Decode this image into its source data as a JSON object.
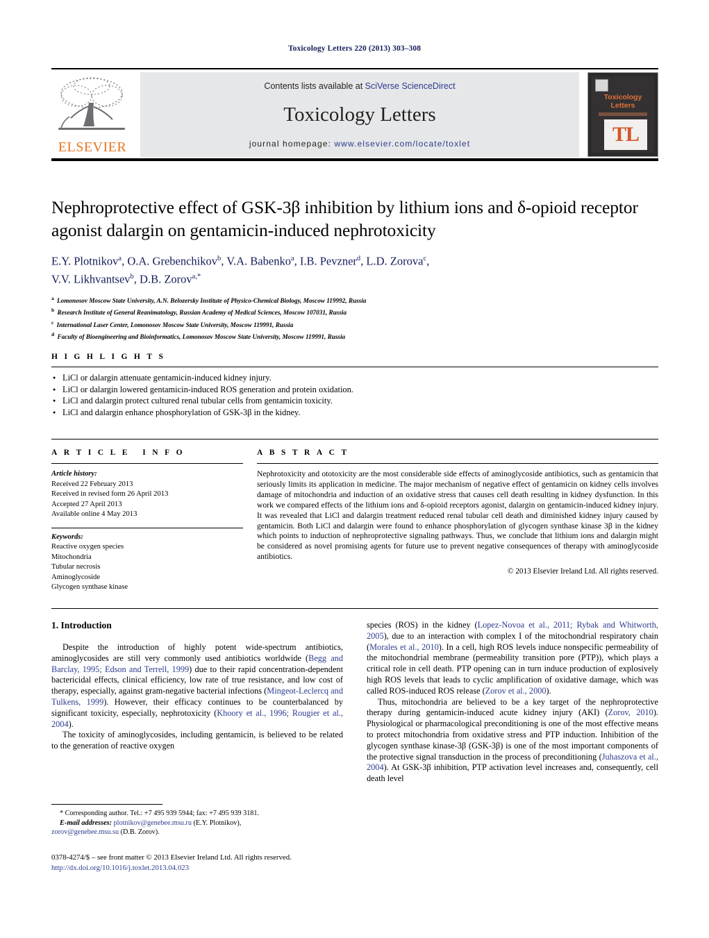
{
  "running_head": "Toxicology Letters 220 (2013) 303–308",
  "masthead": {
    "contents_prefix": "Contents lists available at ",
    "sciencedirect": "SciVerse ScienceDirect",
    "journal_name": "Toxicology Letters",
    "homepage_prefix": "journal homepage: ",
    "homepage_url": "www.elsevier.com/locate/toxlet",
    "publisher_wordmark": "ELSEVIER",
    "cover_title": "Toxicology Letters",
    "cover_monogram": "TL",
    "accent_orange": "#e87722",
    "link_blue": "#2c3b8f",
    "panel_gray": "#e6e7e8"
  },
  "article": {
    "title": "Nephroprotective effect of GSK-3β inhibition by lithium ions and δ-opioid receptor agonist dalargin on gentamicin-induced nephrotoxicity",
    "authors_line_1": "E.Y. Plotnikov<sup>a</sup>, O.A. Grebenchikov<sup>b</sup>, V.A. Babenko<sup>a</sup>, I.B. Pevzner<sup>d</sup>, L.D. Zorova<sup>c</sup>,",
    "authors_line_2": "V.V. Likhvantsev<sup>b</sup>, D.B. Zorov<sup>a,</sup><sup>*</sup>",
    "affiliations": [
      "<sup>a</sup> Lomonosov Moscow State University, A.N. Belozersky Institute of Physico-Chemical Biology, Moscow 119992, Russia",
      "<sup>b</sup> Research Institute of General Reanimatology, Russian Academy of Medical Sciences, Moscow 107031, Russia",
      "<sup>c</sup> International Laser Center, Lomonosov Moscow State University, Moscow 119991, Russia",
      "<sup>d</sup> Faculty of Bioengineering and Bioinformatics, Lomonosov Moscow State University, Moscow 119991, Russia"
    ]
  },
  "highlights": {
    "label": "HIGHLIGHTS",
    "items": [
      "LiCl or dalargin attenuate gentamicin-induced kidney injury.",
      "LiCl or dalargin lowered gentamicin-induced ROS generation and protein oxidation.",
      "LiCl and dalargin protect cultured renal tubular cells from gentamicin toxicity.",
      "LiCl and dalargin enhance phosphorylation of GSK-3β in the kidney."
    ]
  },
  "article_info": {
    "label": "ARTICLE INFO",
    "history_label": "Article history:",
    "history": [
      "Received 22 February 2013",
      "Received in revised form 26 April 2013",
      "Accepted 27 April 2013",
      "Available online 4 May 2013"
    ],
    "keywords_label": "Keywords:",
    "keywords": [
      "Reactive oxygen species",
      "Mitochondria",
      "Tubular necrosis",
      "Aminoglycoside",
      "Glycogen synthase kinase"
    ]
  },
  "abstract": {
    "label": "ABSTRACT",
    "text": "Nephrotoxicity and ototoxicity are the most considerable side effects of aminoglycoside antibiotics, such as gentamicin that seriously limits its application in medicine. The major mechanism of negative effect of gentamicin on kidney cells involves damage of mitochondria and induction of an oxidative stress that causes cell death resulting in kidney dysfunction. In this work we compared effects of the lithium ions and δ-opioid receptors agonist, dalargin on gentamicin-induced kidney injury. It was revealed that LiCl and dalargin treatment reduced renal tubular cell death and diminished kidney injury caused by gentamicin. Both LiCl and dalargin were found to enhance phosphorylation of glycogen synthase kinase 3β in the kidney which points to induction of nephroprotective signaling pathways. Thus, we conclude that lithium ions and dalargin might be considered as novel promising agents for future use to prevent negative consequences of therapy with aminoglycoside antibiotics.",
    "copyright": "© 2013 Elsevier Ireland Ltd. All rights reserved."
  },
  "introduction": {
    "heading": "1. Introduction",
    "left_paragraphs": [
      "Despite the introduction of highly potent wide-spectrum antibiotics, aminoglycosides are still very commonly used antibiotics worldwide (<span class=\"cite\">Begg and Barclay, 1995; Edson and Terrell, 1999</span>) due to their rapid concentration-dependent bactericidal effects, clinical efficiency, low rate of true resistance, and low cost of therapy, especially, against gram-negative bacterial infections (<span class=\"cite\">Mingeot-Leclercq and Tulkens, 1999</span>). However, their efficacy continues to be counterbalanced by significant toxicity, especially, nephrotoxicity (<span class=\"cite\">Khoory et al., 1996; Rougier et al., 2004</span>).",
      "The toxicity of aminoglycosides, including gentamicin, is believed to be related to the generation of reactive oxygen"
    ],
    "right_paragraphs": [
      "species (ROS) in the kidney (<span class=\"cite\">Lopez-Novoa et al., 2011; Rybak and Whitworth, 2005</span>), due to an interaction with complex I of the mitochondrial respiratory chain (<span class=\"cite\">Morales et al., 2010</span>). In a cell, high ROS levels induce nonspecific permeability of the mitochondrial membrane (permeability transition pore (PTP)), which plays a critical role in cell death. PTP opening can in turn induce production of explosively high ROS levels that leads to cyclic amplification of oxidative damage, which was called ROS-induced ROS release (<span class=\"cite\">Zorov et al., 2000</span>).",
      "Thus, mitochondria are believed to be a key target of the nephroprotective therapy during gentamicin-induced acute kidney injury (AKI) (<span class=\"cite\">Zorov, 2010</span>). Physiological or pharmacological preconditioning is one of the most effective means to protect mitochondria from oxidative stress and PTP induction. Inhibition of the glycogen synthase kinase-3β (GSK-3β) is one of the most important components of the protective signal transduction in the process of preconditioning (<span class=\"cite\">Juhaszova et al., 2004</span>). At GSK-3β inhibition, PTP activation level increases and, consequently, cell death level"
    ]
  },
  "footnote": {
    "corresponding": "* Corresponding author. Tel.: +7 495 939 5944; fax: +7 495 939 3181.",
    "email_label": "E-mail addresses:",
    "email_1": "plotnikov@genebee.msu.ru",
    "email_1_owner": "(E.Y. Plotnikov),",
    "email_2": "zorov@genebee.msu.su",
    "email_2_owner": "(D.B. Zorov)."
  },
  "imprint": {
    "line": "0378-4274/$ – see front matter © 2013 Elsevier Ireland Ltd. All rights reserved.",
    "doi": "http://dx.doi.org/10.1016/j.toxlet.2013.04.023"
  }
}
